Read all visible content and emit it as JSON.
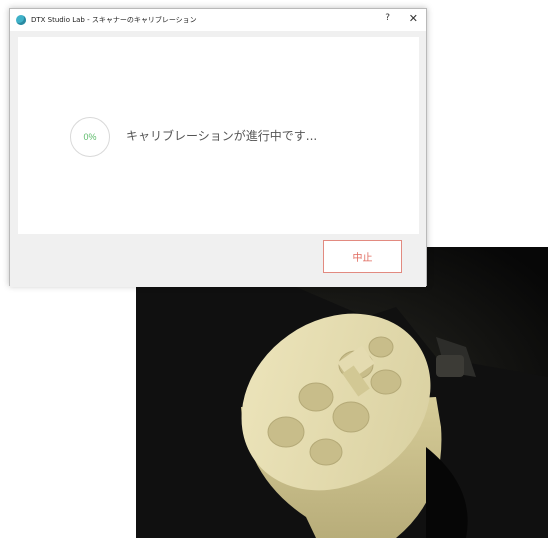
{
  "window": {
    "title": "DTX Studio Lab - スキャナーのキャリブレーション",
    "help_label": "?",
    "close_label": "✕"
  },
  "calibration": {
    "progress_percent": 0,
    "progress_label": "0%",
    "status": "キャリブレーションが進行中です..."
  },
  "footer": {
    "abort_label": "中止"
  },
  "colors": {
    "accent_green": "#5cbb6a",
    "abort_red": "#e06b5f",
    "app_icon": "#3fb1c8"
  }
}
